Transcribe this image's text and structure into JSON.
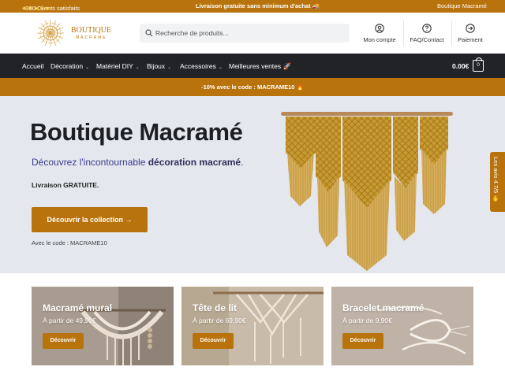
{
  "topbar": {
    "left_text": "+300 Clients satisfaits",
    "stars": "★★★★★",
    "middle_text": "Livraison gratuite sans minimum d'achat 🚚",
    "right_text": "Boutique Macramé"
  },
  "header": {
    "logo_title": "BOUTIQUE",
    "logo_subtitle": "MACRAME",
    "search_placeholder": "Recherche de produits...",
    "account_label": "Mon compte",
    "faq_label": "FAQ/Contact",
    "payment_label": "Paiement"
  },
  "nav": {
    "items": [
      {
        "label": "Accueil",
        "has_menu": false
      },
      {
        "label": "Décoration",
        "has_menu": true
      },
      {
        "label": "Matériel DIY",
        "has_menu": true
      },
      {
        "label": "Bijoux",
        "has_menu": true
      },
      {
        "label": "Accessoires",
        "has_menu": true
      },
      {
        "label": "Meilleures ventes 🚀",
        "has_menu": false
      }
    ],
    "chevron": "⌄",
    "cart_total": "0.00€",
    "cart_count": "0"
  },
  "promo": {
    "text": "-10% avec le code : MACRAME10 🔥"
  },
  "hero": {
    "title": "Boutique Macramé",
    "subtitle_prefix": "Découvrez l'incontournable ",
    "subtitle_bold": "décoration macramé",
    "subtitle_suffix": ".",
    "shipping": "Livraison GRATUITE.",
    "button_label": "Découvrir la collection →",
    "code_text": "Avec le code : MACRAME10"
  },
  "review_tab": {
    "text": "Les avis 4.7/5 ✋"
  },
  "categories": [
    {
      "title": "Macramé mural",
      "price": "À partir de 49,90€",
      "button": "Découvrir"
    },
    {
      "title": "Tête de lit",
      "price": "À partir de 69,90€",
      "button": "Découvrir"
    },
    {
      "title": "Bracelet macramé",
      "price": "À partir de 9,90€",
      "button": "Découvrir"
    }
  ],
  "colors": {
    "brand": "#b8730c",
    "nav_bg": "#222327",
    "hero_bg": "#e4e7ee",
    "subtitle": "#3a3d8f"
  },
  "icons": {
    "account": "user-circle-icon",
    "faq": "question-circle-icon",
    "payment": "arrow-circle-icon",
    "search": "search-icon",
    "cart": "shopping-bag-icon"
  }
}
